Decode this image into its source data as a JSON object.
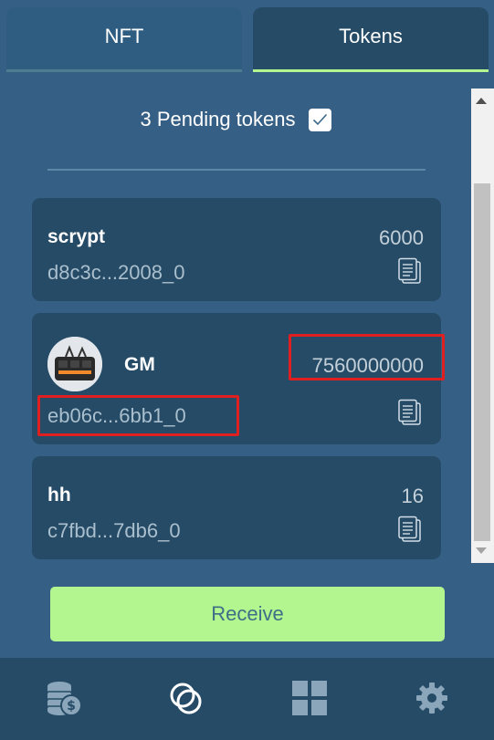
{
  "tabs": [
    {
      "label": "NFT",
      "active": false
    },
    {
      "label": "Tokens",
      "active": true
    }
  ],
  "pending": {
    "label": "3 Pending tokens",
    "checked": true
  },
  "tokens": [
    {
      "name": "scrypt",
      "amount": "6000",
      "id": "d8c3c...2008_0",
      "has_avatar": false
    },
    {
      "name": "GM",
      "amount": "7560000000",
      "id": "eb06c...6bb1_0",
      "has_avatar": true
    },
    {
      "name": "hh",
      "amount": "16",
      "id": "c7fbd...7db6_0",
      "has_avatar": false
    }
  ],
  "receive_label": "Receive",
  "nav": [
    {
      "icon": "coins-dollar-icon",
      "active": false
    },
    {
      "icon": "tokens-icon",
      "active": true
    },
    {
      "icon": "grid-icon",
      "active": false
    },
    {
      "icon": "gear-icon",
      "active": false
    }
  ],
  "colors": {
    "background": "#355f85",
    "card": "#264b66",
    "accent": "#b3f58e",
    "highlight": "#e02020"
  }
}
